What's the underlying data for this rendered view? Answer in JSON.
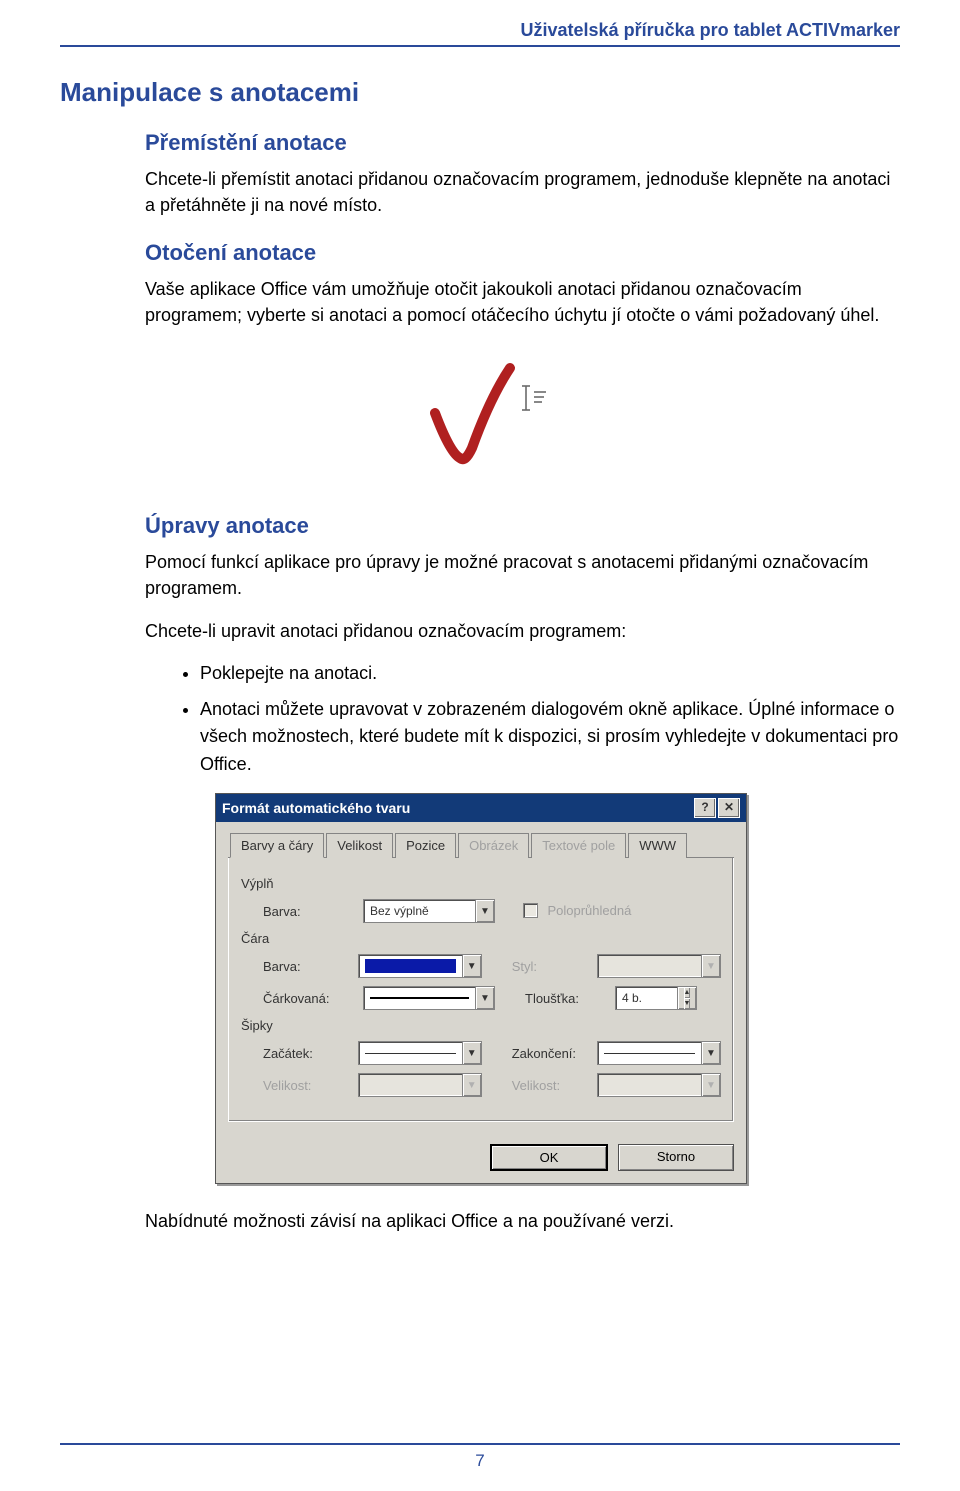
{
  "header": {
    "title": "Uživatelská příručka pro tablet ACTIVmarker"
  },
  "h1": "Manipulace s anotacemi",
  "section1": {
    "title": "Přemístění anotace",
    "body": "Chcete-li přemístit anotaci přidanou označovacím programem, jednoduše klepněte na anotaci a přetáhněte ji na nové místo."
  },
  "section2": {
    "title": "Otočení anotace",
    "body": "Vaše aplikace Office vám umožňuje otočit jakoukoli anotaci přidanou označovacím programem; vyberte si anotaci a pomocí otáčecího úchytu jí otočte o vámi požadovaný úhel."
  },
  "section3": {
    "title": "Úpravy anotace",
    "body1": "Pomocí funkcí aplikace pro úpravy je možné pracovat s anotacemi přidanými označovacím programem.",
    "body2": "Chcete-li upravit anotaci přidanou označovacím programem:",
    "bullets": [
      "Poklepejte na anotaci.",
      "Anotaci můžete upravovat v zobrazeném dialogovém okně aplikace. Úplné informace o všech možnostech, které budete mít k dispozici, si prosím vyhledejte v dokumentaci pro Office."
    ]
  },
  "dialog": {
    "title": "Formát automatického tvaru",
    "help_icon": "?",
    "close_icon": "✕",
    "tabs": [
      "Barvy a čáry",
      "Velikost",
      "Pozice",
      "Obrázek",
      "Textové pole",
      "WWW"
    ],
    "groups": {
      "fill": {
        "label": "Výplň",
        "color_label": "Barva:",
        "color_value": "Bez výplně",
        "semi_label": "Poloprůhledná"
      },
      "line": {
        "label": "Čára",
        "color_label": "Barva:",
        "style_label": "Styl:",
        "dash_label": "Čárkovaná:",
        "weight_label": "Tloušťka:",
        "weight_value": "4 b."
      },
      "arrows": {
        "label": "Šipky",
        "start_label": "Začátek:",
        "end_label": "Zakončení:",
        "startsize_label": "Velikost:",
        "endsize_label": "Velikost:"
      }
    },
    "ok": "OK",
    "cancel": "Storno"
  },
  "closing": "Nabídnuté možnosti závisí na aplikaci Office a na používané verzi.",
  "page_number": "7"
}
